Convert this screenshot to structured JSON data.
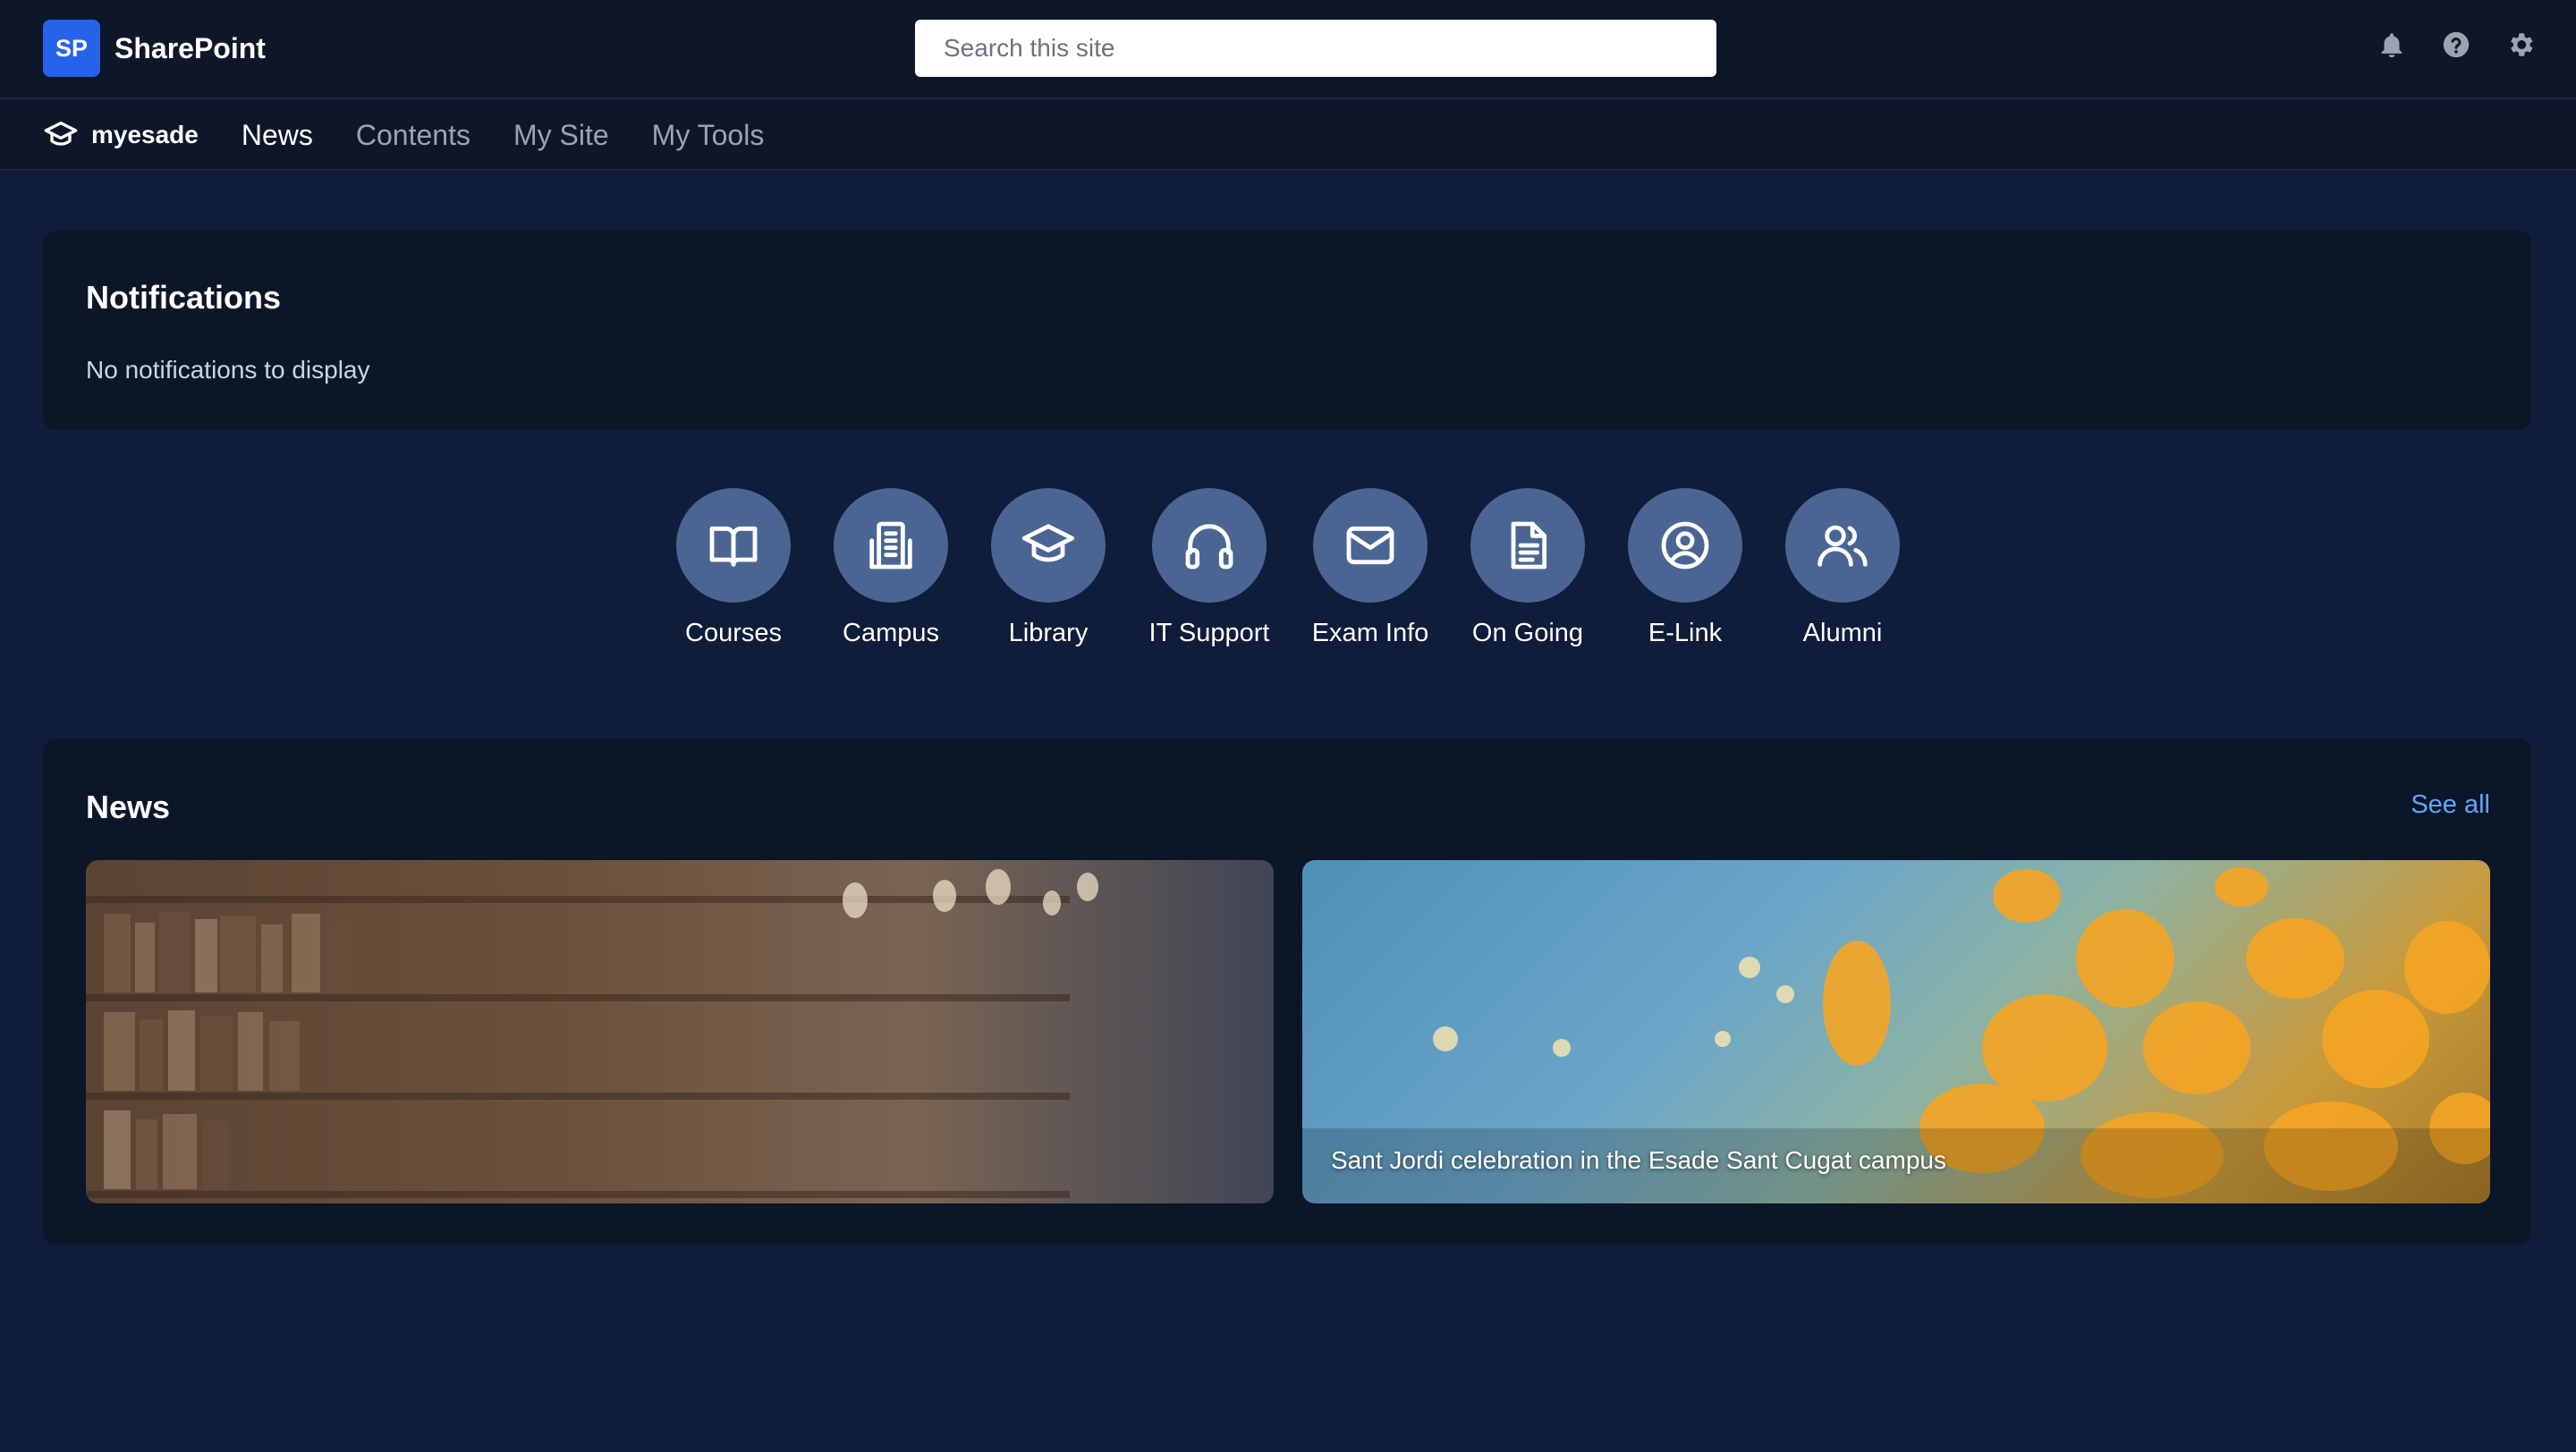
{
  "header": {
    "badge": "SP",
    "app_name": "SharePoint",
    "search_placeholder": "Search this site",
    "icons": [
      "bell-icon",
      "help-icon",
      "gear-icon"
    ]
  },
  "nav": {
    "site_icon": "graduation-cap-icon",
    "site_name": "myesade",
    "links": [
      {
        "label": "News",
        "active": true
      },
      {
        "label": "Contents",
        "active": false
      },
      {
        "label": "My Site",
        "active": false
      },
      {
        "label": "My Tools",
        "active": false
      }
    ]
  },
  "notifications": {
    "title": "Notifications",
    "empty_text": "No notifications to display"
  },
  "quick_links": [
    {
      "label": "Courses",
      "icon": "book-open-icon"
    },
    {
      "label": "Campus",
      "icon": "building-icon"
    },
    {
      "label": "Library",
      "icon": "graduation-cap-icon"
    },
    {
      "label": "IT Support",
      "icon": "headphones-icon"
    },
    {
      "label": "Exam Info",
      "icon": "envelope-icon"
    },
    {
      "label": "On Going",
      "icon": "document-icon"
    },
    {
      "label": "E-Link",
      "icon": "user-circle-icon"
    },
    {
      "label": "Alumni",
      "icon": "users-icon"
    }
  ],
  "news": {
    "title": "News",
    "see_all": "See all",
    "items": [
      {
        "caption": "",
        "image": "library-bookshelves"
      },
      {
        "caption": "Sant Jordi celebration in the Esade Sant Cugat campus",
        "image": "yellow-poppies"
      }
    ]
  },
  "colors": {
    "background": "#0f1d3a",
    "topbar": "#0e1729",
    "card": "#0c1629",
    "accent": "#2563eb",
    "link": "#60a5fa",
    "quicklink_circle": "#4a6592"
  }
}
